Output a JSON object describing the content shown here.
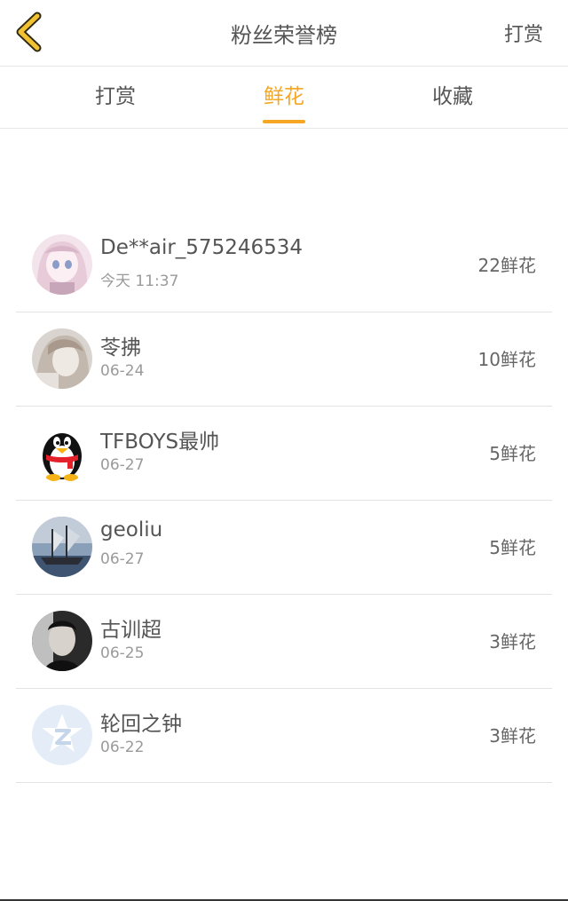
{
  "header": {
    "title": "粉丝荣誉榜",
    "action_label": "打赏",
    "back_icon": "chevron-left-icon",
    "accent_color": "#f5a623"
  },
  "tabs": [
    {
      "label": "打赏",
      "active": false
    },
    {
      "label": "鲜花",
      "active": true
    },
    {
      "label": "收藏",
      "active": false
    }
  ],
  "fans": [
    {
      "name": "De**air_575246534",
      "date": "今天 11:37",
      "count": "22鲜花",
      "avatar_icon": "anime-girl-avatar-icon"
    },
    {
      "name": "苓拂",
      "date": "06-24",
      "count": "10鲜花",
      "avatar_icon": "sketch-girl-avatar-icon"
    },
    {
      "name": "TFBOYS最帅",
      "date": "06-27",
      "count": "5鲜花",
      "avatar_icon": "penguin-avatar-icon"
    },
    {
      "name": "geoliu",
      "date": "06-27",
      "count": "5鲜花",
      "avatar_icon": "ship-painting-avatar-icon"
    },
    {
      "name": "古训超",
      "date": "06-25",
      "count": "3鲜花",
      "avatar_icon": "man-photo-avatar-icon"
    },
    {
      "name": "轮回之钟",
      "date": "06-22",
      "count": "3鲜花",
      "avatar_icon": "star-z-avatar-icon"
    }
  ]
}
